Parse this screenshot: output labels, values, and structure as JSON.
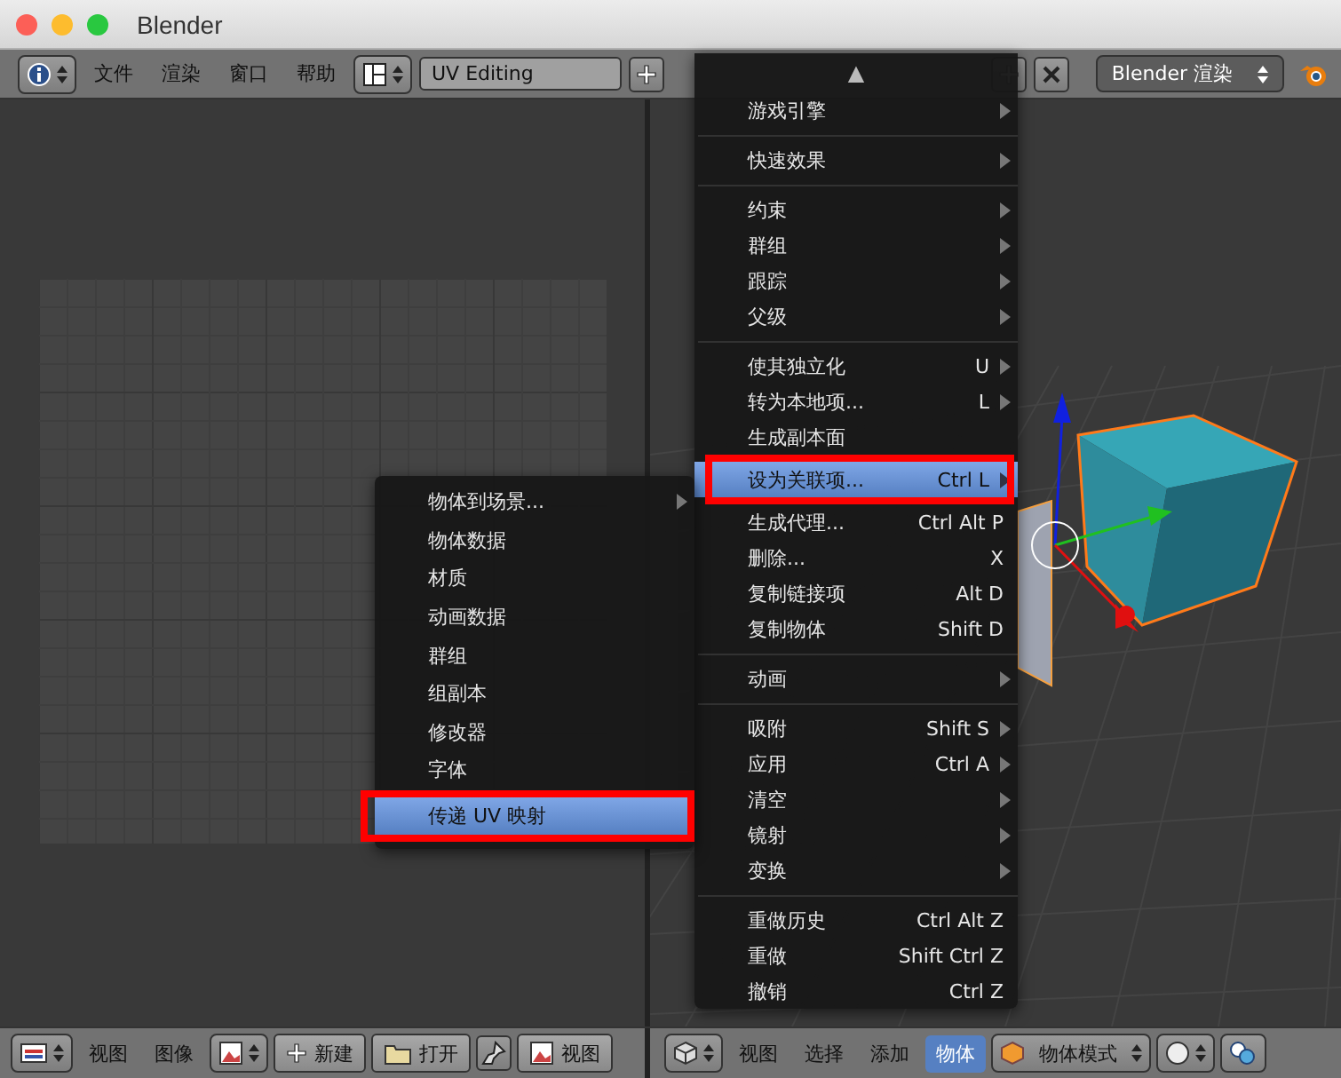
{
  "window": {
    "title": "Blender"
  },
  "top_header": {
    "menus": [
      "文件",
      "渲染",
      "窗口",
      "帮助"
    ],
    "layout": "UV Editing",
    "render_engine": "Blender 渲染"
  },
  "object_menu": {
    "scroll_arrow": "▲",
    "items": [
      {
        "kind": "item",
        "label": "游戏引擎",
        "submenu": true,
        "selected": false
      },
      {
        "kind": "separator"
      },
      {
        "kind": "item",
        "label": "快速效果",
        "submenu": true,
        "selected": false
      },
      {
        "kind": "separator"
      },
      {
        "kind": "item",
        "label": "约束",
        "submenu": true,
        "selected": false
      },
      {
        "kind": "item",
        "label": "群组",
        "submenu": true,
        "selected": false
      },
      {
        "kind": "item",
        "label": "跟踪",
        "submenu": true,
        "selected": false
      },
      {
        "kind": "item",
        "label": "父级",
        "submenu": true,
        "selected": false
      },
      {
        "kind": "separator"
      },
      {
        "kind": "item",
        "label": "使其独立化",
        "shortcut": "U",
        "submenu": true,
        "selected": false
      },
      {
        "kind": "item",
        "label": "转为本地项...",
        "shortcut": "L",
        "submenu": true,
        "selected": false
      },
      {
        "kind": "item",
        "label": "生成副本面",
        "submenu": false,
        "selected": false
      },
      {
        "kind": "item",
        "label": "设为关联项...",
        "shortcut": "Ctrl L",
        "submenu": true,
        "selected": true
      },
      {
        "kind": "item",
        "label": "生成代理...",
        "shortcut": "Ctrl Alt P",
        "submenu": false,
        "selected": false
      },
      {
        "kind": "item",
        "label": "删除...",
        "shortcut": "X",
        "submenu": false,
        "selected": false
      },
      {
        "kind": "item",
        "label": "复制链接项",
        "shortcut": "Alt D",
        "submenu": false,
        "selected": false
      },
      {
        "kind": "item",
        "label": "复制物体",
        "shortcut": "Shift D",
        "submenu": false,
        "selected": false
      },
      {
        "kind": "separator"
      },
      {
        "kind": "item",
        "label": "动画",
        "submenu": true,
        "selected": false
      },
      {
        "kind": "separator"
      },
      {
        "kind": "item",
        "label": "吸附",
        "shortcut": "Shift S",
        "submenu": true,
        "selected": false
      },
      {
        "kind": "item",
        "label": "应用",
        "shortcut": "Ctrl A",
        "submenu": true,
        "selected": false
      },
      {
        "kind": "item",
        "label": "清空",
        "submenu": true,
        "selected": false
      },
      {
        "kind": "item",
        "label": "镜射",
        "submenu": true,
        "selected": false
      },
      {
        "kind": "item",
        "label": "变换",
        "submenu": true,
        "selected": false
      },
      {
        "kind": "separator"
      },
      {
        "kind": "item",
        "label": "重做历史",
        "shortcut": "Ctrl Alt Z",
        "submenu": false,
        "selected": false
      },
      {
        "kind": "item",
        "label": "重做",
        "shortcut": "Shift Ctrl Z",
        "submenu": false,
        "selected": false
      },
      {
        "kind": "item",
        "label": "撤销",
        "shortcut": "Ctrl Z",
        "submenu": false,
        "selected": false
      }
    ]
  },
  "link_submenu": {
    "items": [
      {
        "label": "物体到场景...",
        "submenu": true,
        "selected": false
      },
      {
        "label": "物体数据",
        "submenu": false,
        "selected": false
      },
      {
        "label": "材质",
        "submenu": false,
        "selected": false
      },
      {
        "label": "动画数据",
        "submenu": false,
        "selected": false
      },
      {
        "label": "群组",
        "submenu": false,
        "selected": false
      },
      {
        "label": "组副本",
        "submenu": false,
        "selected": false
      },
      {
        "label": "修改器",
        "submenu": false,
        "selected": false
      },
      {
        "label": "字体",
        "submenu": false,
        "selected": false
      },
      {
        "label": "传递 UV 映射",
        "submenu": false,
        "selected": true
      }
    ]
  },
  "image_editor_header": {
    "menus": [
      "视图",
      "图像"
    ],
    "new_button": "新建",
    "open_button": "打开",
    "view_button": "视图"
  },
  "viewport_header": {
    "menus": [
      {
        "label": "视图",
        "selected": false
      },
      {
        "label": "选择",
        "selected": false
      },
      {
        "label": "添加",
        "selected": false
      },
      {
        "label": "物体",
        "selected": true
      }
    ],
    "mode": "物体模式"
  }
}
